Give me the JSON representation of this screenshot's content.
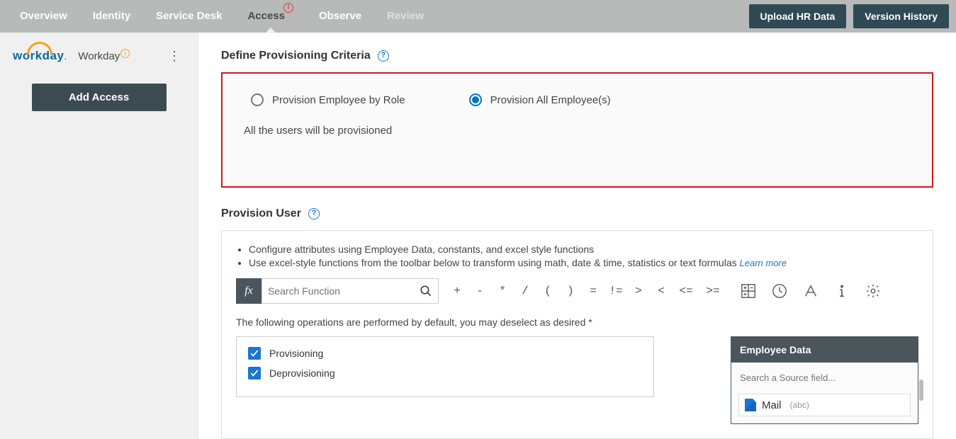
{
  "nav": {
    "tabs": [
      "Overview",
      "Identity",
      "Service Desk",
      "Access",
      "Observe",
      "Review"
    ],
    "active": "Access",
    "upload": "Upload HR Data",
    "version": "Version History"
  },
  "sidebar": {
    "logo_text": "workday",
    "app_name": "Workday",
    "add_access": "Add Access"
  },
  "criteria": {
    "title": "Define Provisioning Criteria",
    "opt_role": "Provision Employee by Role",
    "opt_all": "Provision All Employee(s)",
    "desc": "All the users will be provisioned"
  },
  "provision": {
    "title": "Provision User",
    "bullet1": "Configure attributes using Employee Data, constants, and excel style functions",
    "bullet2": "Use excel-style functions from the toolbar below to transform using math, date & time, statistics or text formulas",
    "learn": "Learn more",
    "fx": "fx",
    "search_placeholder": "Search Function",
    "ops": [
      "+",
      "-",
      "*",
      "/",
      "(",
      ")",
      "=",
      "!=",
      ">",
      "<",
      "<=",
      ">="
    ],
    "ops_desc": "The following operations are performed by default, you may deselect as desired *",
    "chk_prov": "Provisioning",
    "chk_deprov": "Deprovisioning"
  },
  "emp": {
    "title": "Employee Data",
    "search_placeholder": "Search a Source field...",
    "field_name": "Mail",
    "field_type": "(abc)"
  }
}
